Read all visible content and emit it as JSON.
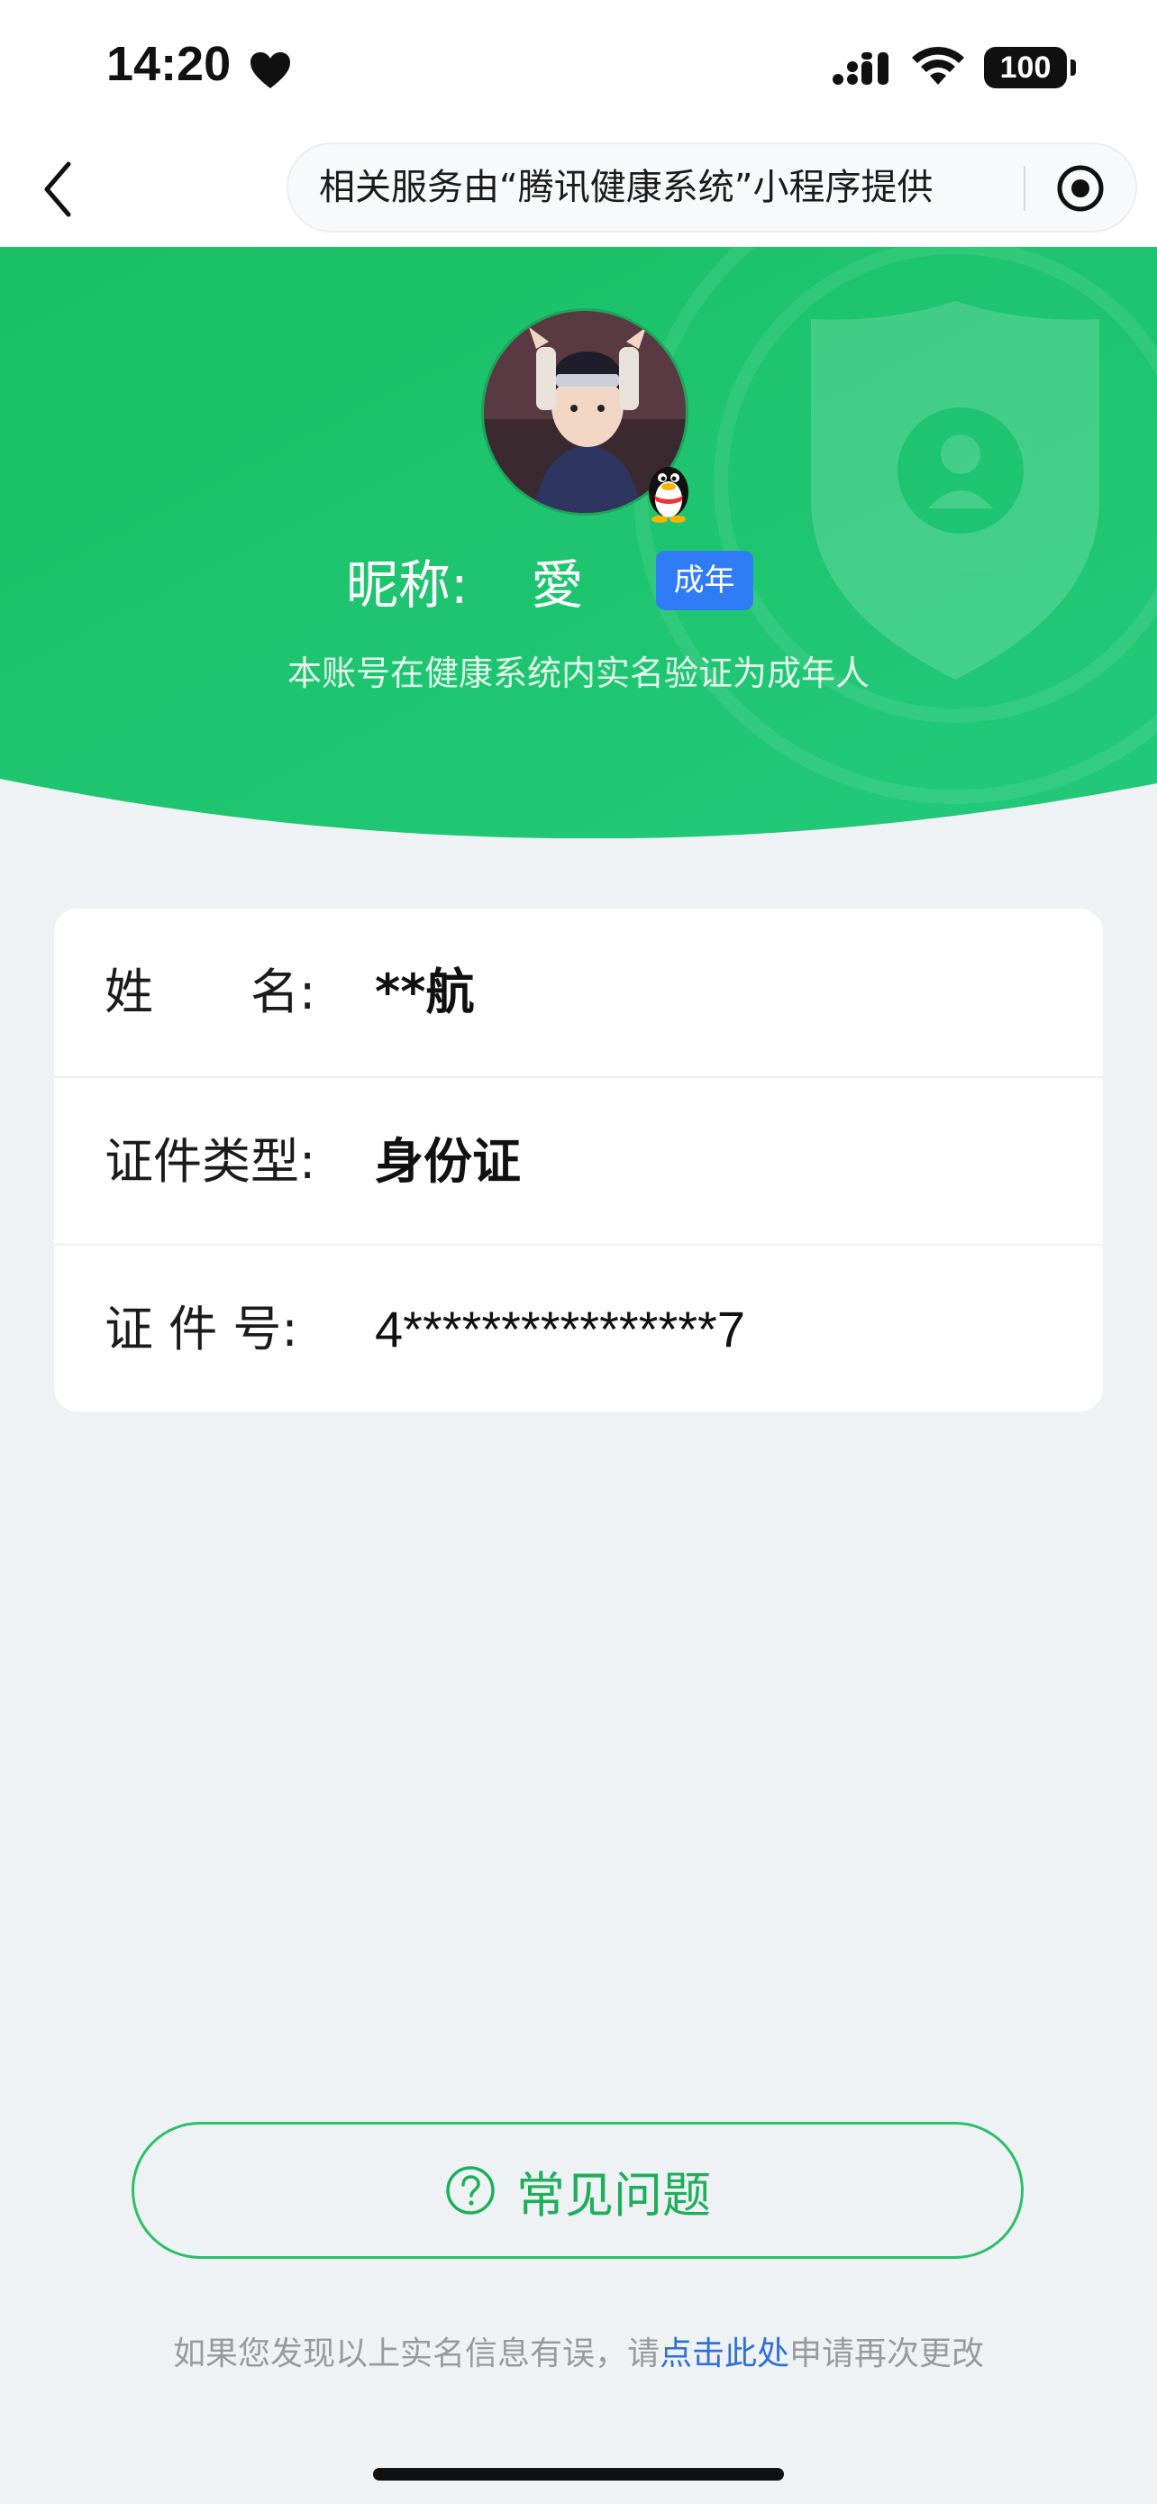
{
  "status_bar": {
    "time": "14:20",
    "battery": "100"
  },
  "nav": {
    "provider_text": "相关服务由“腾讯健康系统”小程序提供"
  },
  "profile": {
    "nickname_label": "昵称:",
    "nickname_value": "愛",
    "age_badge": "成年",
    "verification_note": "本账号在健康系统内实名验证为成年人"
  },
  "info": {
    "rows": [
      {
        "label": "姓　　名:",
        "value": "**航"
      },
      {
        "label": "证件类型:",
        "value": "身份证"
      },
      {
        "label": "证 件 号:",
        "value": "4****************7"
      }
    ]
  },
  "faq": {
    "label": "常见问题"
  },
  "footer": {
    "prefix": "如果您发现以上实名信息有误，请",
    "link": "点击此处",
    "suffix": "申请再次更改"
  },
  "colors": {
    "green_primary": "#1ec46b",
    "badge_blue": "#2f7cf6",
    "link_blue": "#2f6fd8",
    "page_bg": "#eff2f5"
  }
}
